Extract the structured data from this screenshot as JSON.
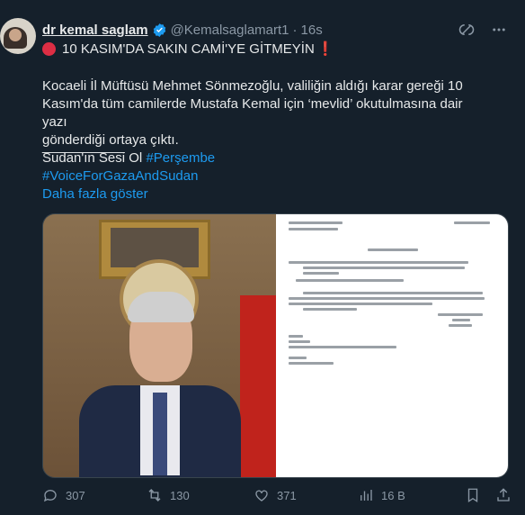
{
  "author": {
    "display_name": "dr kemal saglam",
    "handle": "@Kemalsaglamart1",
    "separator": "·",
    "time": "16s"
  },
  "icons": {
    "verified": "verified-badge-icon",
    "grok": "grok-icon",
    "more": "more-icon",
    "reply": "reply-icon",
    "retweet": "retweet-icon",
    "like": "like-icon",
    "views": "views-icon",
    "bookmark": "bookmark-icon",
    "share": "share-icon"
  },
  "colors": {
    "background": "#15202b",
    "text": "#e7e9ea",
    "muted": "#8b98a5",
    "link": "#1d9bf0",
    "alert_red": "#dd2e44"
  },
  "tweet": {
    "headline": "10 KASIM'DA SAKIN CAMİ'YE GİTMEYİN",
    "headline_suffix": "❗",
    "body_line1": "Kocaeli İl Müftüsü Mehmet Sönmezoğlu, valiliğin aldığı karar gereği 10",
    "body_line2": "Kasım'da tüm camilerde  Mustafa Kemal için ‘mevlid’ okutulmasına dair yazı",
    "body_line3": "gönderdiği ortaya çıktı.",
    "divider": "___________",
    "line_prefix": "Sudan'ın Sesi Ol ",
    "hashtag1": "#Perşembe",
    "hashtag2": "#VoiceForGazaAndSudan",
    "show_more": "Daha fazla göster"
  },
  "stats": {
    "replies": "307",
    "retweets": "130",
    "likes": "371",
    "views": "16 B"
  }
}
